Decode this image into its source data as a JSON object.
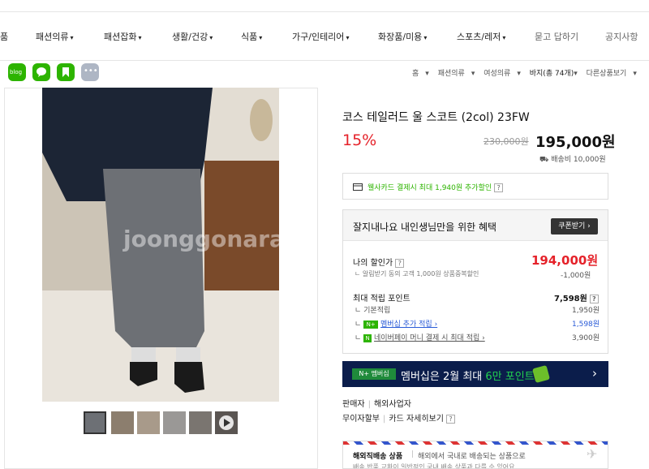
{
  "nav": {
    "items": [
      {
        "label": "품",
        "caret": false
      },
      {
        "label": "패션의류",
        "caret": true
      },
      {
        "label": "패션잡화",
        "caret": true
      },
      {
        "label": "생활/건강",
        "caret": true
      },
      {
        "label": "식품",
        "caret": true
      },
      {
        "label": "가구/인테리어",
        "caret": true
      },
      {
        "label": "화장품/미용",
        "caret": true
      },
      {
        "label": "스포츠/레저",
        "caret": true
      },
      {
        "label": "묻고 답하기",
        "caret": false
      },
      {
        "label": "공지사항",
        "caret": false
      }
    ]
  },
  "share": {
    "blog_label": "blog",
    "more_label": "•••"
  },
  "breadcrumb": {
    "items": [
      "홈",
      "패션의류",
      "여성의류",
      "바지(총 74개)",
      "다른상품보기"
    ]
  },
  "watermark": "joonggonara",
  "product": {
    "title": "코스 테일러드 울 스코트 (2col) 23FW",
    "discount": "15%",
    "original_price": "230,000원",
    "price": "195,000원",
    "shipping": "배송비 10,000원"
  },
  "card_promo": {
    "text": "웰사카드 결제시 최대 1,940원 추가할인",
    "help": "?"
  },
  "benefit": {
    "title": "잘지내나요 내인생님만을 위한 혜택",
    "coupon_button": "쿠폰받기 ›",
    "my_discount_label": "나의 할인가",
    "my_discount_value": "194,000원",
    "alarm_label": "알림받기 동의 고객 1,000원 상품중복할인",
    "alarm_value": "-1,000원",
    "points_label": "최대 적립 포인트",
    "points_value": "7,598원",
    "basic_label": "기본적립",
    "basic_value": "1,950원",
    "membership_label": "멤버십 추가 적립 ›",
    "membership_value": "1,598원",
    "npay_label": "네이버페이 머니 결제 시 최대 적립 ›",
    "npay_value": "3,900원",
    "help": "?"
  },
  "membership_banner": {
    "badge": "N+ 멤버십",
    "text_pre": "멤버십은 2월 최대 ",
    "text_highlight": "6만 포인트",
    "arrow": "›"
  },
  "footer": {
    "seller_label": "판매자",
    "seller_value": "해외사업자",
    "installment_label": "무이자할부",
    "installment_value": "카드 자세히보기",
    "help": "?"
  },
  "overseas": {
    "badge": "해외직배송 상품",
    "text": "해외에서 국내로 배송되는 상품으로",
    "text2": "배송 반품 교환이 일반적인 국내 배송 상품과 다를 수 있어요"
  },
  "colors": {
    "sale_red": "#e5222a",
    "naver_green": "#2db400",
    "banner_navy": "#0b1d4b"
  }
}
